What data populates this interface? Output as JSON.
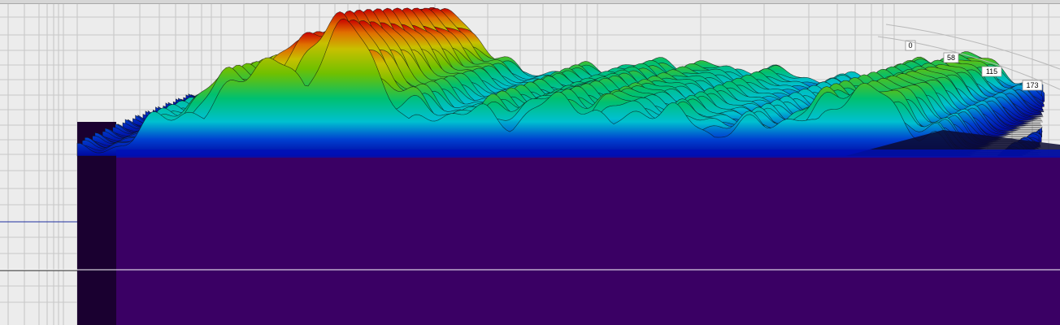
{
  "chart_data": {
    "type": "area",
    "title": "",
    "xlabel": "",
    "ylabel": "",
    "z_axis_ticks": [
      "0",
      "58",
      "115",
      "173"
    ],
    "grid": true,
    "colormap": [
      "#3a0064",
      "#0010b0",
      "#00c0c0",
      "#00c060",
      "#60c000",
      "#c0c000",
      "#e08000",
      "#c00000"
    ],
    "floor_color": "#3a0064",
    "wall_color": "#1a0030"
  }
}
